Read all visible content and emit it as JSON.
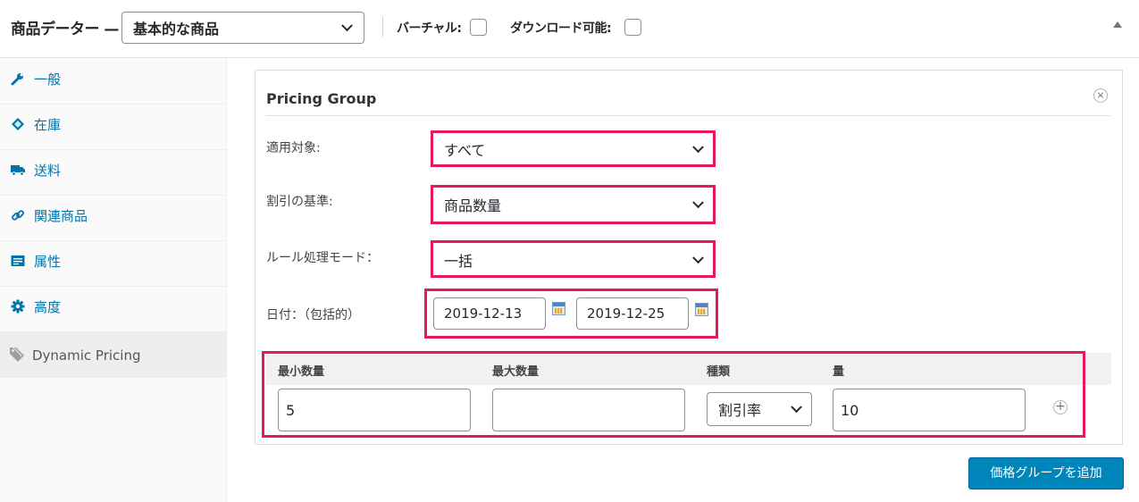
{
  "header": {
    "title": "商品データー —",
    "product_type": "基本的な商品",
    "virtual_label": "バーチャル:",
    "downloadable_label": "ダウンロード可能:"
  },
  "sidebar": {
    "items": [
      {
        "label": "一般",
        "icon": "wrench-icon"
      },
      {
        "label": "在庫",
        "icon": "tag-icon"
      },
      {
        "label": "送料",
        "icon": "truck-icon"
      },
      {
        "label": "関連商品",
        "icon": "link-icon"
      },
      {
        "label": "属性",
        "icon": "list-icon"
      },
      {
        "label": "高度",
        "icon": "gear-icon"
      },
      {
        "label": "Dynamic Pricing",
        "icon": "tags-icon"
      }
    ]
  },
  "pricing_group": {
    "title": "Pricing Group",
    "fields": {
      "applies_to": {
        "label": "適用対象:",
        "value": "すべて"
      },
      "discount_basis": {
        "label": "割引の基準:",
        "value": "商品数量"
      },
      "rule_mode": {
        "label": "ルール処理モード：",
        "value": "一括"
      },
      "dates": {
        "label": "日付：（包括的）",
        "from": "2019-12-13",
        "to": "2019-12-25"
      }
    },
    "table": {
      "headers": [
        "最小数量",
        "最大数量",
        "種類",
        "量"
      ],
      "row": {
        "min_qty": "5",
        "max_qty": "",
        "type": "割引率",
        "amount": "10"
      }
    }
  },
  "add_button": "価格グループを追加",
  "colors": {
    "highlight": "#e6195d",
    "link": "#0073aa",
    "button": "#0085ba"
  }
}
